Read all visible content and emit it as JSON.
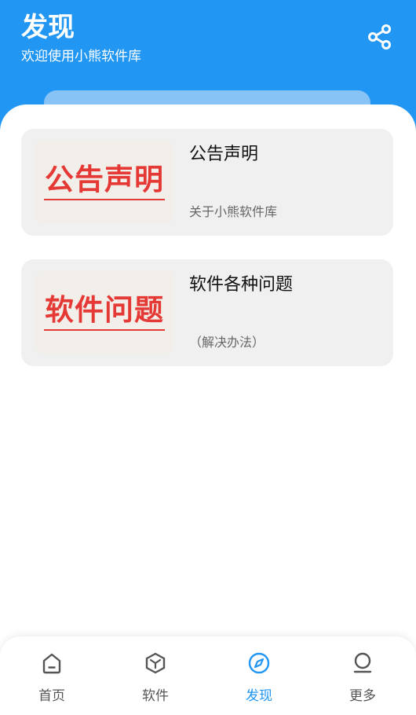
{
  "header": {
    "title": "发现",
    "subtitle": "欢迎使用小熊软件库",
    "share_icon": "share-icon",
    "background_color": "#2196f3"
  },
  "cards": [
    {
      "thumb_text": "公告声明",
      "title": "公告声明",
      "description": "关于小熊软件库"
    },
    {
      "thumb_text": "软件问题",
      "title": "软件各种问题",
      "description": "（解决办法）"
    }
  ],
  "bottom_nav": {
    "items": [
      {
        "label": "首页",
        "icon": "home-icon"
      },
      {
        "label": "软件",
        "icon": "cube-icon"
      },
      {
        "label": "发现",
        "icon": "compass-icon"
      },
      {
        "label": "更多",
        "icon": "profile-icon"
      }
    ],
    "active_index": 2,
    "active_color": "#2196f3",
    "inactive_color": "#555555"
  }
}
